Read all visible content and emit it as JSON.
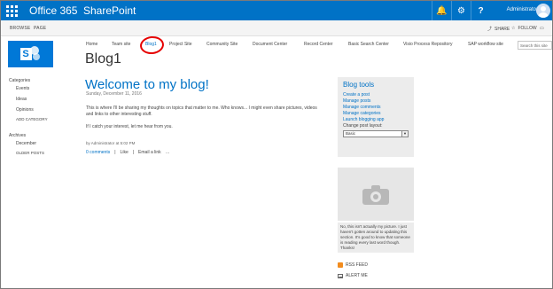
{
  "suitebar": {
    "app_name": "Office 365",
    "product": "SharePoint",
    "user": "Administrator",
    "bell_glyph": "🔔",
    "gear_glyph": "⚙",
    "help_glyph": "?"
  },
  "ribbon": {
    "tabs": [
      "BROWSE",
      "PAGE"
    ],
    "share_label": "SHARE",
    "follow_label": "FOLLOW"
  },
  "topnav": {
    "items": [
      "Home",
      "Team site",
      "Blog1",
      "Project Site",
      "Community Site",
      "Document Center",
      "Record Center",
      "Basic Search Center",
      "Visio Process Repository",
      "SAP workflow site"
    ],
    "active": "Blog1",
    "search_placeholder": "Search this site"
  },
  "site": {
    "title": "Blog1"
  },
  "leftnav": {
    "categories_label": "Categories",
    "categories": [
      "Events",
      "Ideas",
      "Opinions"
    ],
    "add_category": "ADD CATEGORY",
    "archives_label": "Archives",
    "archives": [
      "December"
    ],
    "older_posts": "OLDER POSTS"
  },
  "post": {
    "title": "Welcome to my blog!",
    "date": "Sunday, December 11, 2016",
    "paragraph1": "This is where I'll be sharing my thoughts on topics that matter to me. Who knows... I might even share pictures, videos and links to other interesting stuff.",
    "paragraph2": "If I catch your interest, let me hear from you.",
    "by_prefix": "by",
    "author": "Administrator",
    "at_prefix": "at",
    "time": "5:02 PM",
    "comments": "0 comments",
    "like": "Like",
    "email": "Email a link",
    "more": "…"
  },
  "tools": {
    "title": "Blog tools",
    "links": [
      "Create a post",
      "Manage posts",
      "Manage comments",
      "Manage categories",
      "Launch blogging app"
    ],
    "layout_label": "Change post layout:",
    "layout_value": "Basic"
  },
  "profile": {
    "bio": "No, this isn't actually my picture. I just haven't gotten around to updating this section. It's good to know that someone is reading every last word though. Thanks!"
  },
  "feeds": {
    "rss": "RSS FEED",
    "alert": "ALERT ME"
  },
  "colors": {
    "suitebar": "#0072c6",
    "accent": "#0072c6",
    "annotation_circle": "#e60000"
  }
}
